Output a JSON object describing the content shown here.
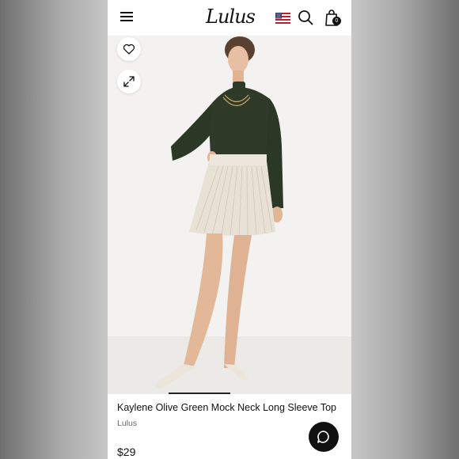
{
  "header": {
    "logo_text": "Lulus",
    "cart_count": "0",
    "icons": [
      "menu-icon",
      "us-flag-icon",
      "search-icon",
      "shopping-bag-icon"
    ]
  },
  "gallery": {
    "icons": [
      "heart-icon",
      "expand-icon"
    ]
  },
  "product": {
    "title": "Kaylene Olive Green Mock Neck Long Sleeve Top",
    "brand": "Lulus",
    "price": "$29"
  },
  "support": {
    "icon": "chat-icon"
  },
  "colors": {
    "background": "#d9d9d9",
    "accent": "#111111",
    "top_color": "#2f3b28",
    "skirt_color": "#e8e1d6"
  }
}
